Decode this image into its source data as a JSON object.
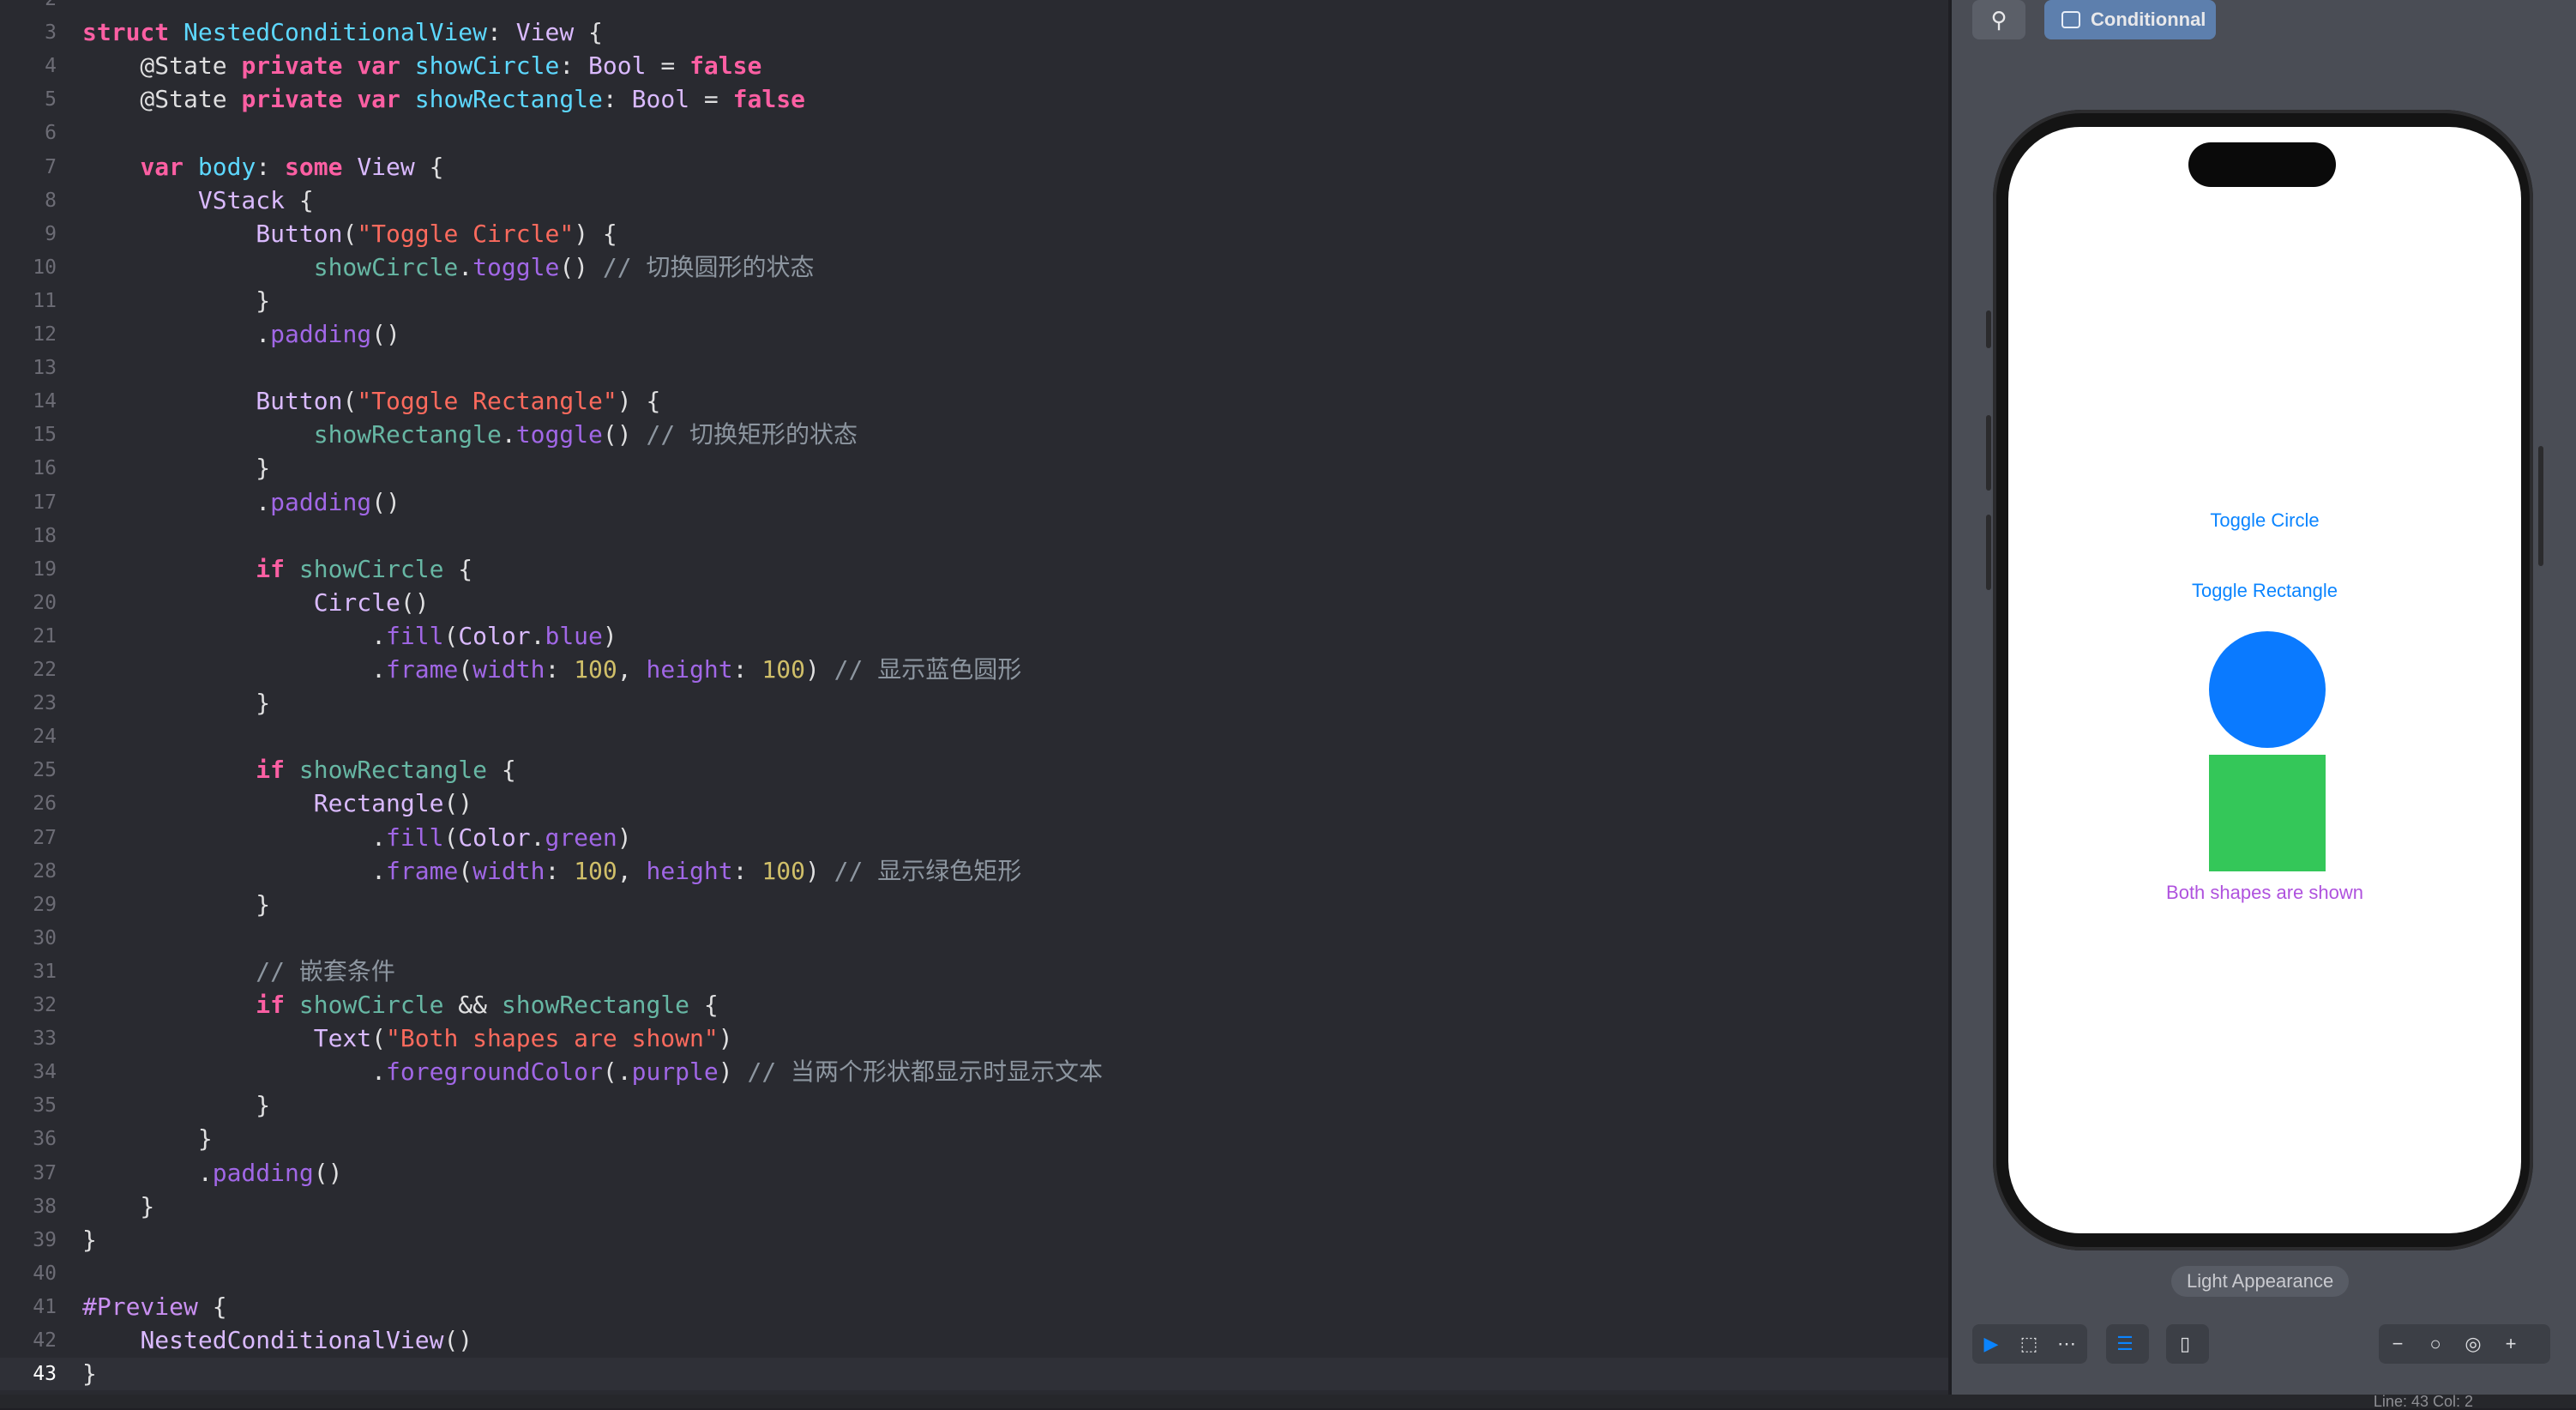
{
  "editor": {
    "current_line": 43,
    "lines": [
      {
        "n": "2",
        "tokens": []
      },
      {
        "n": "3",
        "tokens": [
          {
            "t": "struct",
            "c": "kw"
          },
          {
            "t": " ",
            "c": ""
          },
          {
            "t": "NestedConditionalView",
            "c": "tn"
          },
          {
            "t": ": ",
            "c": ""
          },
          {
            "t": "View",
            "c": "ty"
          },
          {
            "t": " {",
            "c": ""
          }
        ]
      },
      {
        "n": "4",
        "tokens": [
          {
            "t": "    @State ",
            "c": ""
          },
          {
            "t": "private",
            "c": "kw"
          },
          {
            "t": " ",
            "c": ""
          },
          {
            "t": "var",
            "c": "kw"
          },
          {
            "t": " ",
            "c": ""
          },
          {
            "t": "showCircle",
            "c": "tn"
          },
          {
            "t": ": ",
            "c": ""
          },
          {
            "t": "Bool",
            "c": "ty"
          },
          {
            "t": " = ",
            "c": ""
          },
          {
            "t": "false",
            "c": "kw"
          }
        ]
      },
      {
        "n": "5",
        "tokens": [
          {
            "t": "    @State ",
            "c": ""
          },
          {
            "t": "private",
            "c": "kw"
          },
          {
            "t": " ",
            "c": ""
          },
          {
            "t": "var",
            "c": "kw"
          },
          {
            "t": " ",
            "c": ""
          },
          {
            "t": "showRectangle",
            "c": "tn"
          },
          {
            "t": ": ",
            "c": ""
          },
          {
            "t": "Bool",
            "c": "ty"
          },
          {
            "t": " = ",
            "c": ""
          },
          {
            "t": "false",
            "c": "kw"
          }
        ]
      },
      {
        "n": "6",
        "tokens": []
      },
      {
        "n": "7",
        "tokens": [
          {
            "t": "    ",
            "c": ""
          },
          {
            "t": "var",
            "c": "kw"
          },
          {
            "t": " ",
            "c": ""
          },
          {
            "t": "body",
            "c": "tn"
          },
          {
            "t": ": ",
            "c": ""
          },
          {
            "t": "some",
            "c": "kw"
          },
          {
            "t": " ",
            "c": ""
          },
          {
            "t": "View",
            "c": "ty"
          },
          {
            "t": " {",
            "c": ""
          }
        ]
      },
      {
        "n": "8",
        "tokens": [
          {
            "t": "        ",
            "c": ""
          },
          {
            "t": "VStack",
            "c": "ty"
          },
          {
            "t": " {",
            "c": ""
          }
        ]
      },
      {
        "n": "9",
        "tokens": [
          {
            "t": "            ",
            "c": ""
          },
          {
            "t": "Button",
            "c": "ty"
          },
          {
            "t": "(",
            "c": ""
          },
          {
            "t": "\"Toggle Circle\"",
            "c": "st"
          },
          {
            "t": ") {",
            "c": ""
          }
        ]
      },
      {
        "n": "10",
        "tokens": [
          {
            "t": "                ",
            "c": ""
          },
          {
            "t": "showCircle",
            "c": "vr"
          },
          {
            "t": ".",
            "c": ""
          },
          {
            "t": "toggle",
            "c": "pr"
          },
          {
            "t": "() ",
            "c": ""
          },
          {
            "t": "// 切换圆形的状态",
            "c": "cm"
          }
        ]
      },
      {
        "n": "11",
        "tokens": [
          {
            "t": "            }",
            "c": ""
          }
        ]
      },
      {
        "n": "12",
        "tokens": [
          {
            "t": "            .",
            "c": ""
          },
          {
            "t": "padding",
            "c": "pr"
          },
          {
            "t": "()",
            "c": ""
          }
        ]
      },
      {
        "n": "13",
        "tokens": []
      },
      {
        "n": "14",
        "tokens": [
          {
            "t": "            ",
            "c": ""
          },
          {
            "t": "Button",
            "c": "ty"
          },
          {
            "t": "(",
            "c": ""
          },
          {
            "t": "\"Toggle Rectangle\"",
            "c": "st"
          },
          {
            "t": ") {",
            "c": ""
          }
        ]
      },
      {
        "n": "15",
        "tokens": [
          {
            "t": "                ",
            "c": ""
          },
          {
            "t": "showRectangle",
            "c": "vr"
          },
          {
            "t": ".",
            "c": ""
          },
          {
            "t": "toggle",
            "c": "pr"
          },
          {
            "t": "() ",
            "c": ""
          },
          {
            "t": "// 切换矩形的状态",
            "c": "cm"
          }
        ]
      },
      {
        "n": "16",
        "tokens": [
          {
            "t": "            }",
            "c": ""
          }
        ]
      },
      {
        "n": "17",
        "tokens": [
          {
            "t": "            .",
            "c": ""
          },
          {
            "t": "padding",
            "c": "pr"
          },
          {
            "t": "()",
            "c": ""
          }
        ]
      },
      {
        "n": "18",
        "tokens": []
      },
      {
        "n": "19",
        "tokens": [
          {
            "t": "            ",
            "c": ""
          },
          {
            "t": "if",
            "c": "kw"
          },
          {
            "t": " ",
            "c": ""
          },
          {
            "t": "showCircle",
            "c": "vr"
          },
          {
            "t": " {",
            "c": ""
          }
        ]
      },
      {
        "n": "20",
        "tokens": [
          {
            "t": "                ",
            "c": ""
          },
          {
            "t": "Circle",
            "c": "ty"
          },
          {
            "t": "()",
            "c": ""
          }
        ]
      },
      {
        "n": "21",
        "tokens": [
          {
            "t": "                    .",
            "c": ""
          },
          {
            "t": "fill",
            "c": "pr"
          },
          {
            "t": "(",
            "c": ""
          },
          {
            "t": "Color",
            "c": "ty"
          },
          {
            "t": ".",
            "c": ""
          },
          {
            "t": "blue",
            "c": "pr"
          },
          {
            "t": ")",
            "c": ""
          }
        ]
      },
      {
        "n": "22",
        "tokens": [
          {
            "t": "                    .",
            "c": ""
          },
          {
            "t": "frame",
            "c": "pr"
          },
          {
            "t": "(",
            "c": ""
          },
          {
            "t": "width",
            "c": "pr"
          },
          {
            "t": ": ",
            "c": ""
          },
          {
            "t": "100",
            "c": "nu"
          },
          {
            "t": ", ",
            "c": ""
          },
          {
            "t": "height",
            "c": "pr"
          },
          {
            "t": ": ",
            "c": ""
          },
          {
            "t": "100",
            "c": "nu"
          },
          {
            "t": ") ",
            "c": ""
          },
          {
            "t": "// 显示蓝色圆形",
            "c": "cm"
          }
        ]
      },
      {
        "n": "23",
        "tokens": [
          {
            "t": "            }",
            "c": ""
          }
        ]
      },
      {
        "n": "24",
        "tokens": []
      },
      {
        "n": "25",
        "tokens": [
          {
            "t": "            ",
            "c": ""
          },
          {
            "t": "if",
            "c": "kw"
          },
          {
            "t": " ",
            "c": ""
          },
          {
            "t": "showRectangle",
            "c": "vr"
          },
          {
            "t": " {",
            "c": ""
          }
        ]
      },
      {
        "n": "26",
        "tokens": [
          {
            "t": "                ",
            "c": ""
          },
          {
            "t": "Rectangle",
            "c": "ty"
          },
          {
            "t": "()",
            "c": ""
          }
        ]
      },
      {
        "n": "27",
        "tokens": [
          {
            "t": "                    .",
            "c": ""
          },
          {
            "t": "fill",
            "c": "pr"
          },
          {
            "t": "(",
            "c": ""
          },
          {
            "t": "Color",
            "c": "ty"
          },
          {
            "t": ".",
            "c": ""
          },
          {
            "t": "green",
            "c": "pr"
          },
          {
            "t": ")",
            "c": ""
          }
        ]
      },
      {
        "n": "28",
        "tokens": [
          {
            "t": "                    .",
            "c": ""
          },
          {
            "t": "frame",
            "c": "pr"
          },
          {
            "t": "(",
            "c": ""
          },
          {
            "t": "width",
            "c": "pr"
          },
          {
            "t": ": ",
            "c": ""
          },
          {
            "t": "100",
            "c": "nu"
          },
          {
            "t": ", ",
            "c": ""
          },
          {
            "t": "height",
            "c": "pr"
          },
          {
            "t": ": ",
            "c": ""
          },
          {
            "t": "100",
            "c": "nu"
          },
          {
            "t": ") ",
            "c": ""
          },
          {
            "t": "// 显示绿色矩形",
            "c": "cm"
          }
        ]
      },
      {
        "n": "29",
        "tokens": [
          {
            "t": "            }",
            "c": ""
          }
        ]
      },
      {
        "n": "30",
        "tokens": []
      },
      {
        "n": "31",
        "tokens": [
          {
            "t": "            ",
            "c": ""
          },
          {
            "t": "// 嵌套条件",
            "c": "cm"
          }
        ]
      },
      {
        "n": "32",
        "tokens": [
          {
            "t": "            ",
            "c": ""
          },
          {
            "t": "if",
            "c": "kw"
          },
          {
            "t": " ",
            "c": ""
          },
          {
            "t": "showCircle",
            "c": "vr"
          },
          {
            "t": " && ",
            "c": ""
          },
          {
            "t": "showRectangle",
            "c": "vr"
          },
          {
            "t": " {",
            "c": ""
          }
        ]
      },
      {
        "n": "33",
        "tokens": [
          {
            "t": "                ",
            "c": ""
          },
          {
            "t": "Text",
            "c": "ty"
          },
          {
            "t": "(",
            "c": ""
          },
          {
            "t": "\"Both shapes are shown\"",
            "c": "st"
          },
          {
            "t": ")",
            "c": ""
          }
        ]
      },
      {
        "n": "34",
        "tokens": [
          {
            "t": "                    .",
            "c": ""
          },
          {
            "t": "foregroundColor",
            "c": "pr"
          },
          {
            "t": "(.",
            "c": ""
          },
          {
            "t": "purple",
            "c": "pr"
          },
          {
            "t": ") ",
            "c": ""
          },
          {
            "t": "// 当两个形状都显示时显示文本",
            "c": "cm"
          }
        ]
      },
      {
        "n": "35",
        "tokens": [
          {
            "t": "            }",
            "c": ""
          }
        ]
      },
      {
        "n": "36",
        "tokens": [
          {
            "t": "        }",
            "c": ""
          }
        ]
      },
      {
        "n": "37",
        "tokens": [
          {
            "t": "        .",
            "c": ""
          },
          {
            "t": "padding",
            "c": "pr"
          },
          {
            "t": "()",
            "c": ""
          }
        ]
      },
      {
        "n": "38",
        "tokens": [
          {
            "t": "    }",
            "c": ""
          }
        ]
      },
      {
        "n": "39",
        "tokens": [
          {
            "t": "}",
            "c": ""
          }
        ]
      },
      {
        "n": "40",
        "tokens": []
      },
      {
        "n": "41",
        "tokens": [
          {
            "t": "#Preview",
            "c": "ma"
          },
          {
            "t": " {",
            "c": ""
          }
        ]
      },
      {
        "n": "42",
        "tokens": [
          {
            "t": "    ",
            "c": ""
          },
          {
            "t": "NestedConditionalView",
            "c": "ty"
          },
          {
            "t": "()",
            "c": ""
          }
        ]
      },
      {
        "n": "43",
        "tokens": [
          {
            "t": "}",
            "c": ""
          }
        ]
      }
    ]
  },
  "preview": {
    "pin_icon": "pin-icon",
    "tab_label": "Conditionnal",
    "toggle_circle_label": "Toggle Circle",
    "toggle_rectangle_label": "Toggle Rectangle",
    "both_shapes_text": "Both shapes are shown",
    "circle_color": "#0a7aff",
    "rectangle_color": "#34c759",
    "text_color": "#af52de",
    "appearance_label": "Light Appearance"
  },
  "bottom_bar": {
    "left_group": [
      {
        "icon": "live-preview-icon",
        "glyph": "▶",
        "active": true
      },
      {
        "icon": "selectable-mode-icon",
        "glyph": "⬚",
        "active": false
      },
      {
        "icon": "variants-grid-icon",
        "glyph": "⋯",
        "active": false
      }
    ],
    "middle_group": [
      {
        "icon": "device-settings-icon",
        "glyph": "☰",
        "active": true
      }
    ],
    "device_group": [
      {
        "icon": "device-icon",
        "glyph": "▯",
        "active": false
      }
    ],
    "zoom_group": [
      {
        "icon": "zoom-out-icon",
        "glyph": "−",
        "active": false
      },
      {
        "icon": "zoom-100-icon",
        "glyph": "○",
        "active": false
      },
      {
        "icon": "zoom-fit-icon",
        "glyph": "◎",
        "active": false
      },
      {
        "icon": "zoom-in-icon",
        "glyph": "+",
        "active": false
      }
    ]
  },
  "status": {
    "text": "Line: 43  Col: 2"
  }
}
